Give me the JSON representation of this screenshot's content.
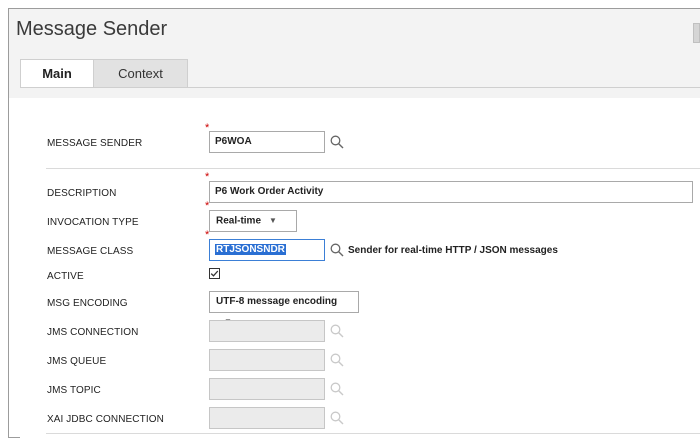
{
  "window": {
    "title": "Message Sender"
  },
  "tabs": [
    {
      "label": "Main",
      "active": true
    },
    {
      "label": "Context",
      "active": false
    }
  ],
  "form": {
    "message_sender": {
      "label": "MESSAGE SENDER",
      "value": "P6WOA",
      "required": true
    },
    "description": {
      "label": "DESCRIPTION",
      "value": "P6 Work Order Activity",
      "required": true
    },
    "invocation_type": {
      "label": "INVOCATION TYPE",
      "value": "Real-time",
      "required": true
    },
    "message_class": {
      "label": "MESSAGE CLASS",
      "value": "RTJSONSNDR",
      "description": "Sender for real-time HTTP / JSON messages",
      "required": true
    },
    "active": {
      "label": "ACTIVE",
      "checked": true
    },
    "msg_encoding": {
      "label": "MSG ENCODING",
      "value": "UTF-8 message encoding"
    },
    "jms_connection": {
      "label": "JMS CONNECTION",
      "value": ""
    },
    "jms_queue": {
      "label": "JMS QUEUE",
      "value": ""
    },
    "jms_topic": {
      "label": "JMS TOPIC",
      "value": ""
    },
    "xai_jdbc_connection": {
      "label": "XAI JDBC CONNECTION",
      "value": ""
    }
  },
  "colors": {
    "required": "#cc0000",
    "selection": "#2a6fd3",
    "tab_inactive": "#e2e2e2"
  },
  "icons": {
    "search": "search-icon",
    "caret": "chevron-down-icon",
    "check": "checkbox-checked-icon"
  }
}
